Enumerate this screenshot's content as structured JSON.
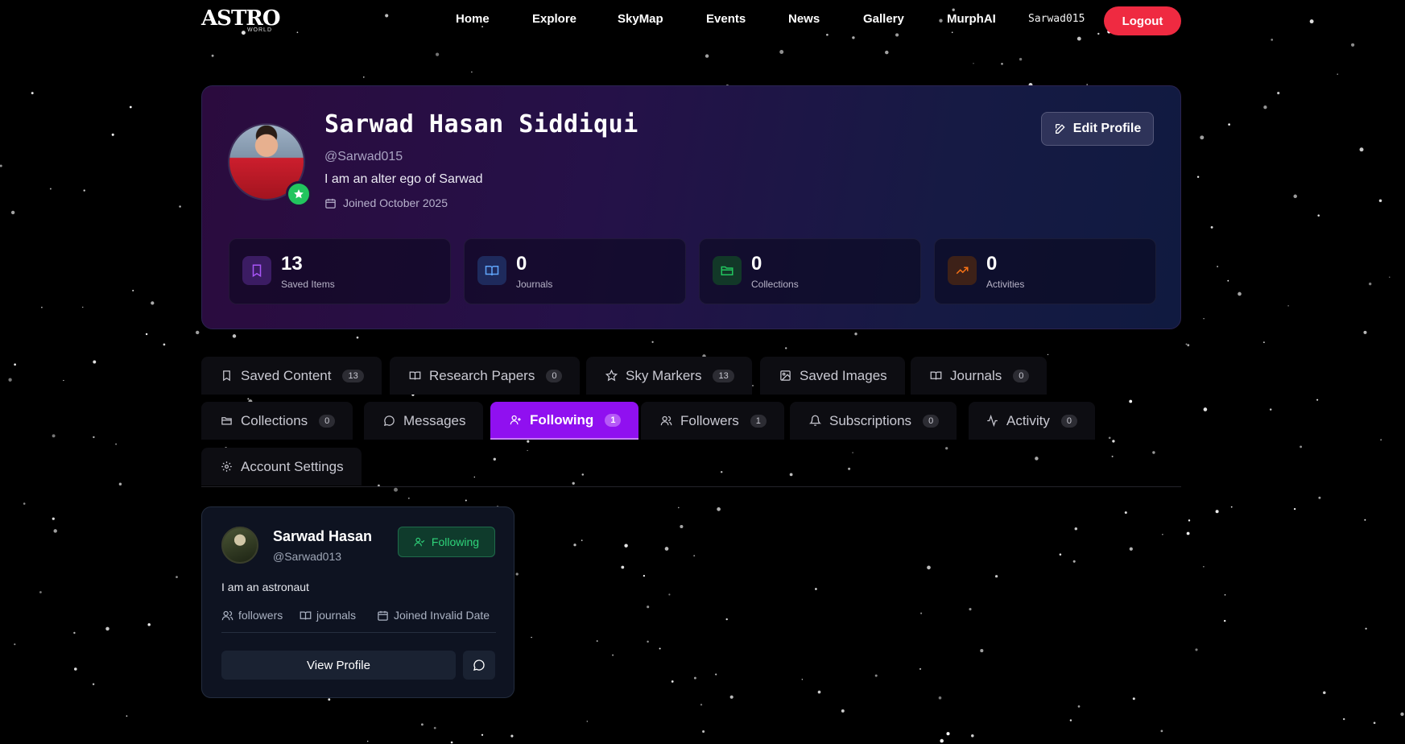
{
  "nav": {
    "logo_text": "ASTRO",
    "logo_sub": "WORLD",
    "links": [
      "Home",
      "Explore",
      "SkyMap",
      "Events",
      "News",
      "Gallery",
      "MurphAI"
    ],
    "username": "Sarwad015",
    "logout_label": "Logout"
  },
  "profile": {
    "name": "Sarwad Hasan Siddiqui",
    "handle": "@Sarwad015",
    "bio": "I am an alter ego of Sarwad",
    "joined": "Joined October 2025",
    "edit_label": "Edit Profile",
    "stats": [
      {
        "value": "13",
        "label": "Saved Items",
        "icon": "bookmark-icon",
        "color": "#a855f7"
      },
      {
        "value": "0",
        "label": "Journals",
        "icon": "book-icon",
        "color": "#60a5fa"
      },
      {
        "value": "0",
        "label": "Collections",
        "icon": "folder-icon",
        "color": "#22c55e"
      },
      {
        "value": "0",
        "label": "Activities",
        "icon": "trending-icon",
        "color": "#f97316"
      }
    ]
  },
  "tabs": [
    {
      "label": "Saved Content",
      "count": "13",
      "icon": "bookmark-icon"
    },
    {
      "label": "Research Papers",
      "count": "0",
      "icon": "book-icon"
    },
    {
      "label": "Sky Markers",
      "count": "13",
      "icon": "star-icon"
    },
    {
      "label": "Saved Images",
      "icon": "image-icon"
    },
    {
      "label": "Journals",
      "count": "0",
      "icon": "book-icon"
    },
    {
      "label": "Collections",
      "count": "0",
      "icon": "folder-icon"
    },
    {
      "label": "Messages",
      "icon": "message-icon"
    },
    {
      "label": "Following",
      "count": "1",
      "icon": "user-plus-icon",
      "active": true
    },
    {
      "label": "Followers",
      "count": "1",
      "icon": "users-icon"
    },
    {
      "label": "Subscriptions",
      "count": "0",
      "icon": "bell-icon"
    },
    {
      "label": "Activity",
      "count": "0",
      "icon": "activity-icon"
    },
    {
      "label": "Account Settings",
      "icon": "gear-icon"
    }
  ],
  "following": {
    "name": "Sarwad Hasan",
    "handle": "@Sarwad013",
    "status_label": "Following",
    "bio": "I am an astronaut",
    "meta_followers": "followers",
    "meta_journals": "journals",
    "meta_joined": "Joined Invalid Date",
    "view_label": "View Profile"
  },
  "colors": {
    "accent": "#9010f0",
    "logout": "#ef2a41",
    "following_green": "#2fd47a"
  }
}
